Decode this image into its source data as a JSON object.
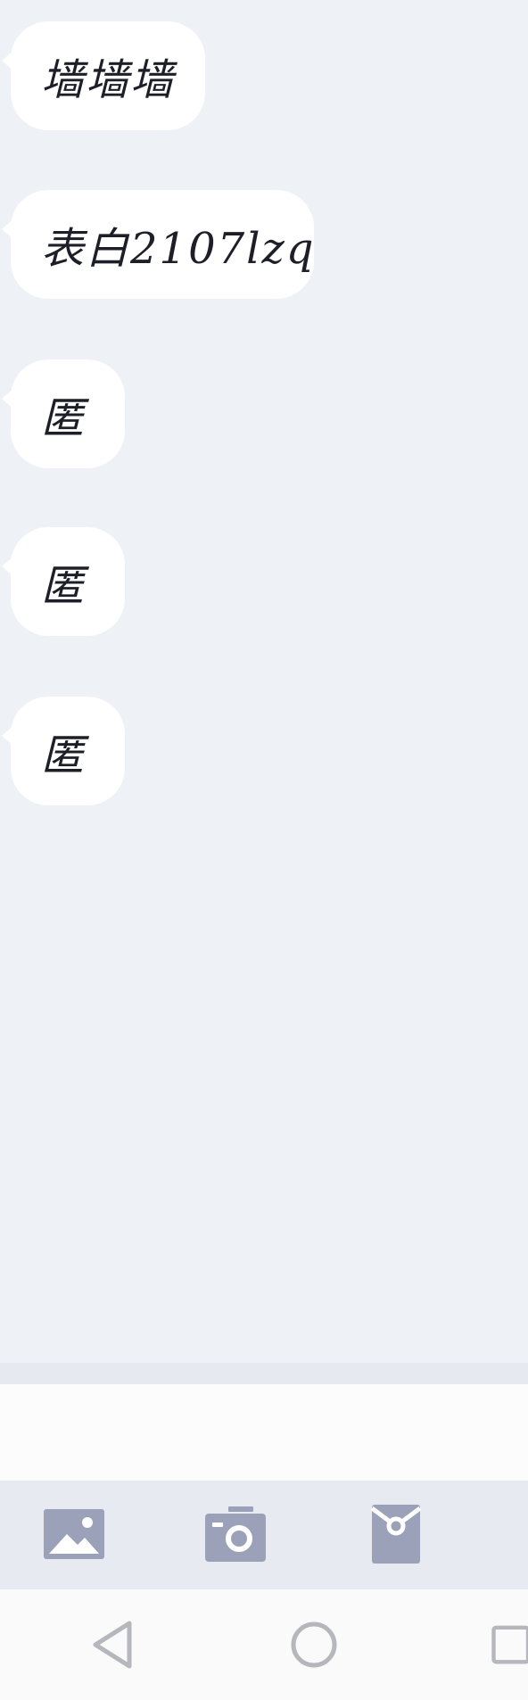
{
  "messages": [
    {
      "text": "墙墙墙"
    },
    {
      "text": "表白2107lzq"
    },
    {
      "text": "匿"
    },
    {
      "text": "匿"
    },
    {
      "text": "匿"
    }
  ],
  "composer": {
    "value": "",
    "placeholder": ""
  },
  "toolbar": {
    "items": [
      {
        "icon": "image-icon"
      },
      {
        "icon": "camera-icon"
      },
      {
        "icon": "red-packet-icon"
      }
    ],
    "icon_color": "#9ba1b8"
  },
  "system_nav": {
    "items": [
      {
        "icon": "back-triangle-icon"
      },
      {
        "icon": "home-circle-icon"
      },
      {
        "icon": "recents-square-icon"
      }
    ],
    "icon_color": "#b5b7bd"
  }
}
